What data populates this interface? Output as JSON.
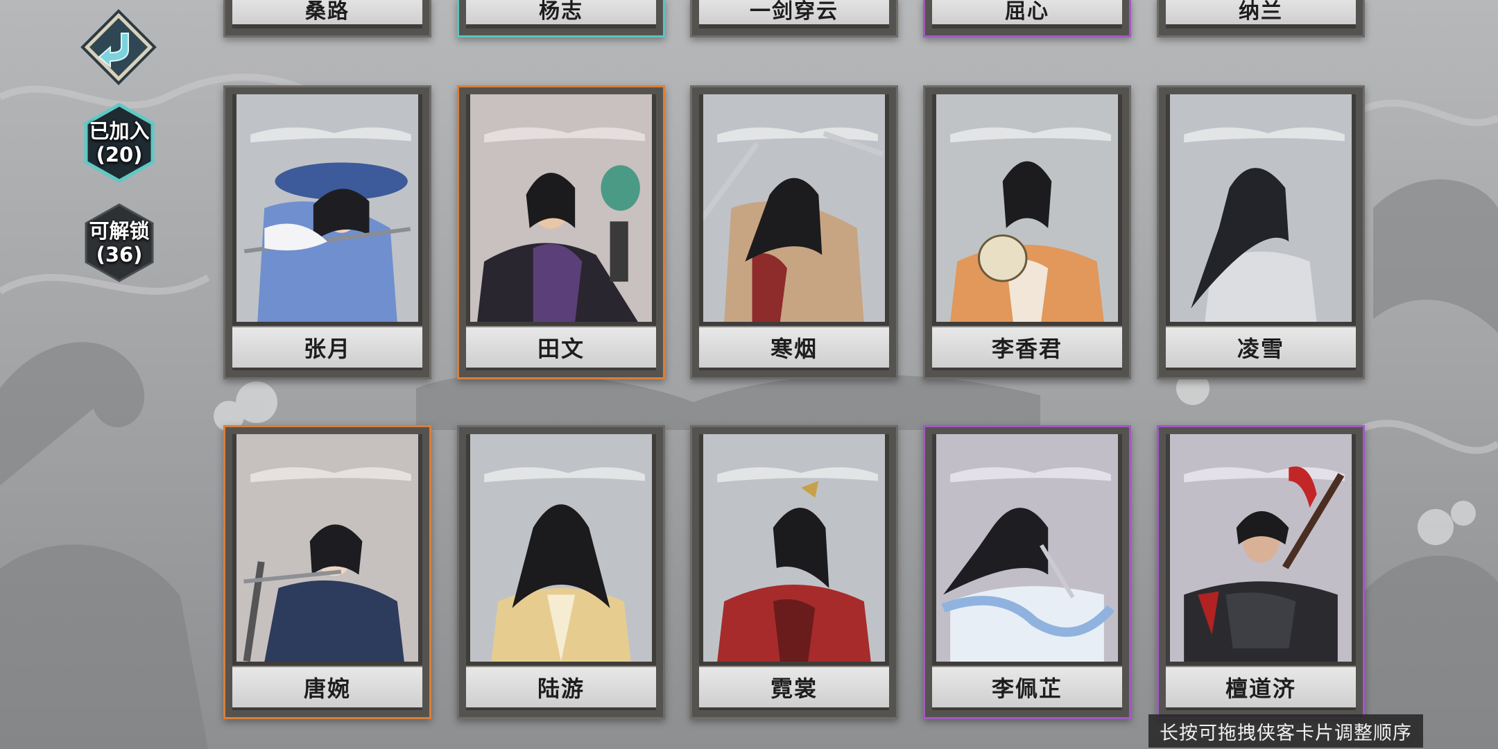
{
  "side_nav": {
    "back_icon": "back-arrow-icon",
    "joined_label": "已加入",
    "joined_count": "(20)",
    "unlock_label": "可解锁",
    "unlock_count": "(36)"
  },
  "top_row_cards": [
    {
      "name": "桑路",
      "rarity": "gray"
    },
    {
      "name": "杨志",
      "rarity": "teal"
    },
    {
      "name": "一剑穿云",
      "rarity": "gray"
    },
    {
      "name": "屈心",
      "rarity": "purple"
    },
    {
      "name": "纳兰",
      "rarity": "gray"
    }
  ],
  "cards": [
    {
      "name": "张月",
      "rarity": "gray"
    },
    {
      "name": "田文",
      "rarity": "orange"
    },
    {
      "name": "寒烟",
      "rarity": "gray"
    },
    {
      "name": "李香君",
      "rarity": "gray"
    },
    {
      "name": "凌雪",
      "rarity": "gray"
    },
    {
      "name": "唐婉",
      "rarity": "orange"
    },
    {
      "name": "陆游",
      "rarity": "gray"
    },
    {
      "name": "霓裳",
      "rarity": "gray"
    },
    {
      "name": "李佩芷",
      "rarity": "purple"
    },
    {
      "name": "檀道济",
      "rarity": "purple"
    }
  ],
  "hint": "长按可拖拽侠客卡片调整顺序",
  "colors": {
    "orange": "#d9803a",
    "purple": "#a159c4",
    "teal": "#5cc4c0",
    "hex_border": "#5fc9c4"
  }
}
